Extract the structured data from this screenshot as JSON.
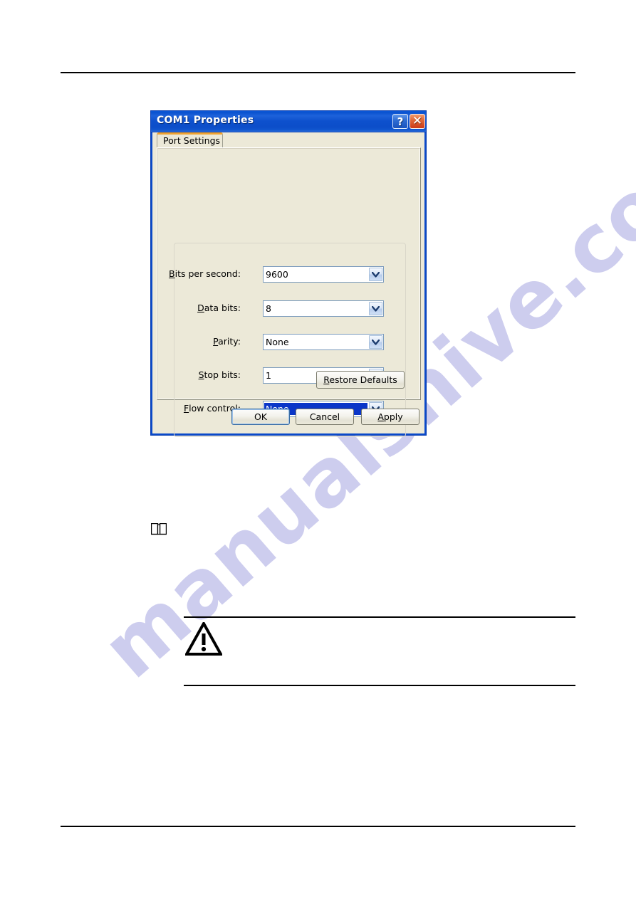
{
  "page": {
    "watermark": "manualshive.com",
    "note_icon": "open-book-icon",
    "caution_icon": "warning-triangle-icon"
  },
  "dialog": {
    "title": "COM1 Properties",
    "title_buttons": {
      "help": "?",
      "close": "✕"
    },
    "tabs": [
      {
        "label": "Port Settings",
        "active": true
      }
    ],
    "fields": [
      {
        "label_prefix": "",
        "accel": "B",
        "label_suffix": "its per second:",
        "value": "9600",
        "focused": false,
        "name": "bits-per-second"
      },
      {
        "label_prefix": "",
        "accel": "D",
        "label_suffix": "ata bits:",
        "value": "8",
        "focused": false,
        "name": "data-bits"
      },
      {
        "label_prefix": "",
        "accel": "P",
        "label_suffix": "arity:",
        "value": "None",
        "focused": false,
        "name": "parity"
      },
      {
        "label_prefix": "",
        "accel": "S",
        "label_suffix": "top bits:",
        "value": "1",
        "focused": false,
        "name": "stop-bits"
      },
      {
        "label_prefix": "",
        "accel": "F",
        "label_suffix": "low control:",
        "value": "None",
        "focused": true,
        "name": "flow-control"
      }
    ],
    "buttons": {
      "restore_defaults": {
        "accel": "R",
        "rest": "estore Defaults"
      },
      "ok": {
        "accel": "",
        "rest": "OK",
        "default": true
      },
      "cancel": {
        "accel": "",
        "rest": "Cancel",
        "default": false
      },
      "apply": {
        "accel": "A",
        "rest": "pply",
        "default": false
      }
    }
  },
  "colors": {
    "title_bar_blue": "#0d50cd",
    "dialog_face": "#ece9d8",
    "tab_accent_orange": "#f0a330",
    "selection_blue": "#0a36c8",
    "close_button_red": "#cc3a17",
    "watermark": "#cdcdee"
  }
}
